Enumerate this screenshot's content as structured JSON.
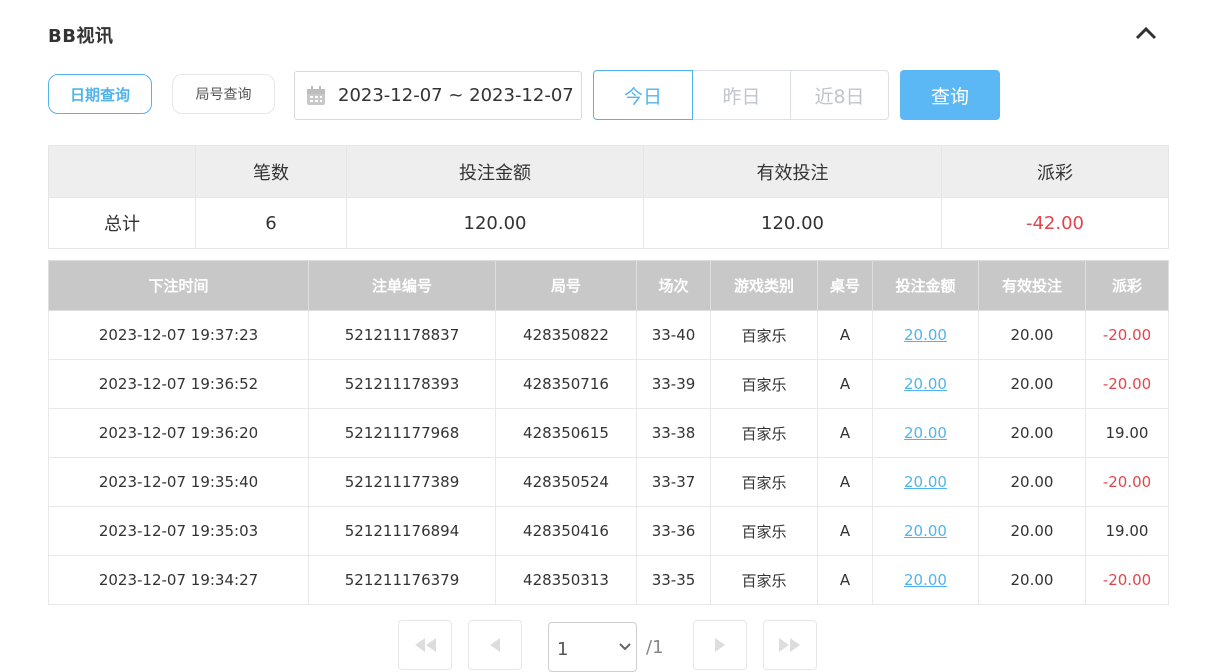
{
  "header": {
    "title": "BB视讯"
  },
  "filters": {
    "mode_date": "日期查询",
    "mode_round": "局号查询",
    "date_range": "2023-12-07 ~ 2023-12-07",
    "quick_today": "今日",
    "quick_yesterday": "昨日",
    "quick_8days": "近8日",
    "query": "查询"
  },
  "summary": {
    "headers": [
      "",
      "笔数",
      "投注金额",
      "有效投注",
      "派彩"
    ],
    "row": [
      "总计",
      "6",
      "120.00",
      "120.00",
      "-42.00"
    ]
  },
  "table": {
    "headers": [
      "下注时间",
      "注单编号",
      "局号",
      "场次",
      "游戏类别",
      "桌号",
      "投注金额",
      "有效投注",
      "派彩"
    ],
    "rows": [
      [
        "2023-12-07 19:37:23",
        "521211178837",
        "428350822",
        "33-40",
        "百家乐",
        "A",
        "20.00",
        "20.00",
        "-20.00"
      ],
      [
        "2023-12-07 19:36:52",
        "521211178393",
        "428350716",
        "33-39",
        "百家乐",
        "A",
        "20.00",
        "20.00",
        "-20.00"
      ],
      [
        "2023-12-07 19:36:20",
        "521211177968",
        "428350615",
        "33-38",
        "百家乐",
        "A",
        "20.00",
        "20.00",
        "19.00"
      ],
      [
        "2023-12-07 19:35:40",
        "521211177389",
        "428350524",
        "33-37",
        "百家乐",
        "A",
        "20.00",
        "20.00",
        "-20.00"
      ],
      [
        "2023-12-07 19:35:03",
        "521211176894",
        "428350416",
        "33-36",
        "百家乐",
        "A",
        "20.00",
        "20.00",
        "19.00"
      ],
      [
        "2023-12-07 19:34:27",
        "521211176379",
        "428350313",
        "33-35",
        "百家乐",
        "A",
        "20.00",
        "20.00",
        "-20.00"
      ]
    ]
  },
  "pagination": {
    "current": "1",
    "total": "/1"
  },
  "icons": {
    "collapse": "chevron-up-icon",
    "calendar": "calendar-icon",
    "first": "double-chevron-left-icon",
    "prev": "chevron-left-icon",
    "next": "chevron-right-icon",
    "last": "double-chevron-right-icon"
  },
  "colors": {
    "accent": "#52b4ec",
    "negative": "#e0464d",
    "header_gray": "#c8c8c8"
  }
}
